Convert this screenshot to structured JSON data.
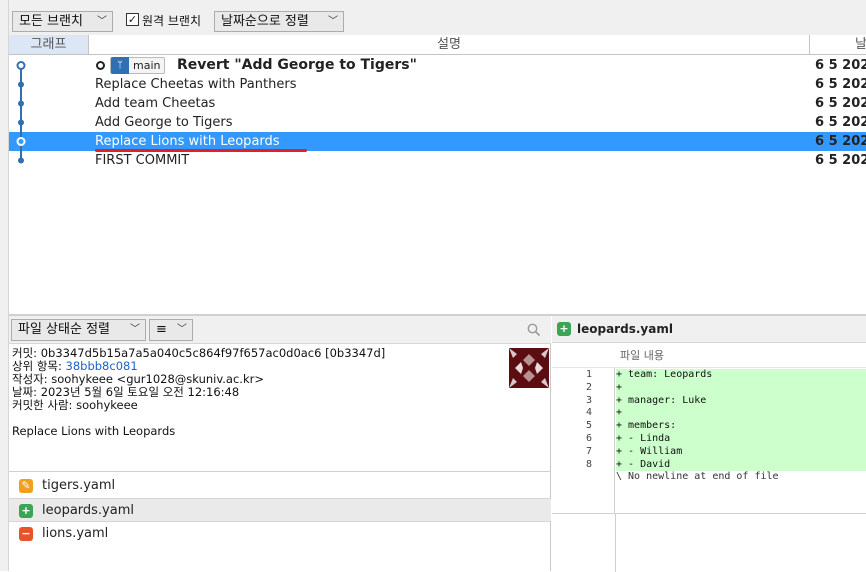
{
  "toolbar": {
    "branches_dropdown": "모든 브랜치",
    "remote_branches_label": "원격 브랜치",
    "remote_branches_checked": true,
    "sort_dropdown": "날짜순으로 정렬"
  },
  "columns": {
    "graph": "그래프",
    "description": "설명",
    "date": "날"
  },
  "commits": [
    {
      "message": "Revert \"Add George to Tigers\"",
      "date": "6 5 202",
      "branch": "main",
      "head": true
    },
    {
      "message": "Replace Cheetas with Panthers",
      "date": "6 5 202"
    },
    {
      "message": "Add team Cheetas",
      "date": "6 5 202"
    },
    {
      "message": "Add George to Tigers",
      "date": "6 5 202"
    },
    {
      "message": "Replace Lions with Leopards",
      "date": "6 5 202",
      "selected": true
    },
    {
      "message": "FIRST COMMIT",
      "date": "6 5 202"
    }
  ],
  "file_panel": {
    "sort_dropdown": "파일 상태순 정렬",
    "view_dropdown": "≡"
  },
  "commit_detail": {
    "commit_label": "커밋:",
    "commit_value": "0b3347d5b15a7a5a040c5c864f97f657ac0d0ac6 [0b3347d]",
    "parent_label": "상위 항목:",
    "parent_value": "38bbb8c081",
    "author_label": "작성자:",
    "author_value": "soohykeee <gur1028@skuniv.ac.kr>",
    "date_label": "날짜:",
    "date_value": "2023년 5월 6일 토요일 오전 12:16:48",
    "committer_label": "커밋한 사람:",
    "committer_value": "soohykeee",
    "message": "Replace Lions with Leopards"
  },
  "files": [
    {
      "name": "tigers.yaml",
      "status": "modified",
      "icon": "pencil-icon",
      "color": "#f0a020"
    },
    {
      "name": "leopards.yaml",
      "status": "added",
      "icon": "plus-icon",
      "color": "#3aa655",
      "selected": true
    },
    {
      "name": "lions.yaml",
      "status": "removed",
      "icon": "minus-icon",
      "color": "#e8542a"
    }
  ],
  "diff": {
    "filename": "leopards.yaml",
    "subheader": "파일 내용",
    "lines": [
      {
        "num": "1",
        "text": "+ team: Leopards"
      },
      {
        "num": "2",
        "text": "+"
      },
      {
        "num": "3",
        "text": "+ manager: Luke"
      },
      {
        "num": "4",
        "text": "+"
      },
      {
        "num": "5",
        "text": "+ members:"
      },
      {
        "num": "6",
        "text": "+ - Linda"
      },
      {
        "num": "7",
        "text": "+ - William"
      },
      {
        "num": "8",
        "text": "+ - David"
      }
    ],
    "trailer": "\\ No newline at end of file"
  },
  "colors": {
    "selection": "#3399ff",
    "graph_line": "#2f6fb3",
    "added_bg": "#ccffcc",
    "annotation_red": "#e0202a"
  }
}
